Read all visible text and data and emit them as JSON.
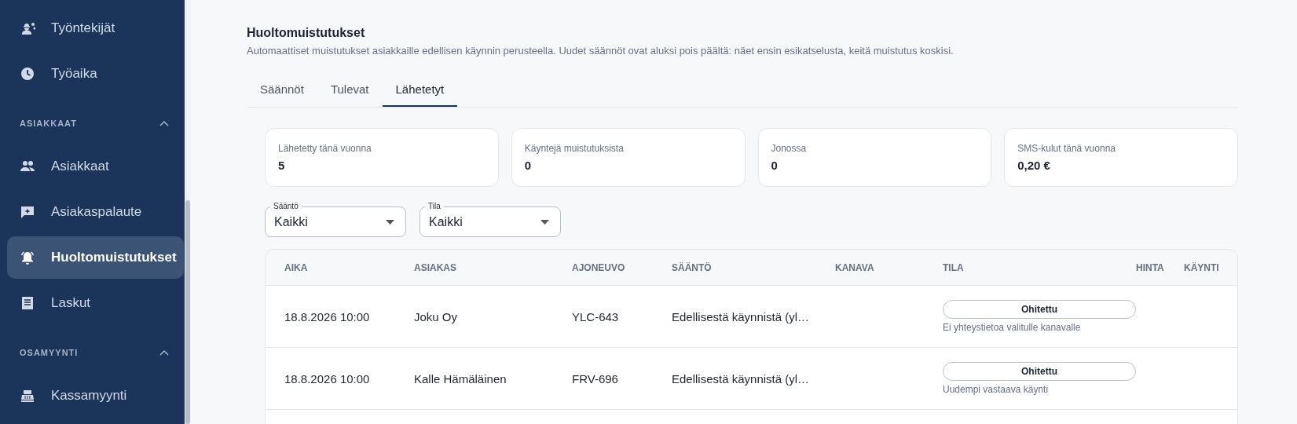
{
  "sidebar": {
    "entries": [
      {
        "kind": "item",
        "label": "Työntekijät",
        "selected": false
      },
      {
        "kind": "item",
        "label": "Työaika",
        "selected": false
      },
      {
        "kind": "section",
        "label": "ASIAKKAAT",
        "expanded": true
      },
      {
        "kind": "item",
        "label": "Asiakkaat",
        "selected": false
      },
      {
        "kind": "item",
        "label": "Asiakaspalaute",
        "selected": false
      },
      {
        "kind": "item",
        "label": "Huoltomuistutukset",
        "selected": true
      },
      {
        "kind": "item",
        "label": "Laskut",
        "selected": false
      },
      {
        "kind": "section",
        "label": "OSAMYYNTI",
        "expanded": true
      },
      {
        "kind": "item",
        "label": "Kassamyynti",
        "selected": false
      }
    ]
  },
  "page": {
    "title": "Huoltomuistutukset",
    "description": "Automaattiset muistutukset asiakkaille edellisen käynnin perusteella. Uudet säännöt ovat aluksi pois päältä: näet ensin esikatselusta, keitä muistutus koskisi.",
    "tabs": [
      {
        "label": "Säännöt",
        "selected": false
      },
      {
        "label": "Tulevat",
        "selected": false
      },
      {
        "label": "Lähetetyt",
        "selected": true
      }
    ],
    "stats": [
      {
        "label": "Lähetetty tänä vuonna",
        "value": "5"
      },
      {
        "label": "Käyntejä muistutuksista",
        "value": "0"
      },
      {
        "label": "Jonossa",
        "value": "0"
      },
      {
        "label": "SMS-kulut tänä vuonna",
        "value": "0,20 €"
      }
    ],
    "filters": [
      {
        "label": "Sääntö",
        "value": "Kaikki"
      },
      {
        "label": "Tila",
        "value": "Kaikki"
      }
    ],
    "table": {
      "columns": [
        "AIKA",
        "ASIAKAS",
        "AJONEUVO",
        "SÄÄNTÖ",
        "KANAVA",
        "TILA",
        "HINTA",
        "KÄYNTI"
      ],
      "rows": [
        {
          "time": "18.8.2026 10:00",
          "customer": "Joku Oy",
          "vehicle": "YLC-643",
          "rule": "Edellisestä käynnistä (yl…",
          "status": "Ohitettu",
          "status_note": "Ei yhteystietoa valitulle kanavalle"
        },
        {
          "time": "18.8.2026 10:00",
          "customer": "Kalle Hämäläinen",
          "vehicle": "FRV-696",
          "rule": "Edellisestä käynnistä (yl…",
          "status": "Ohitettu",
          "status_note": "Uudempi vastaava käynti"
        }
      ]
    }
  }
}
